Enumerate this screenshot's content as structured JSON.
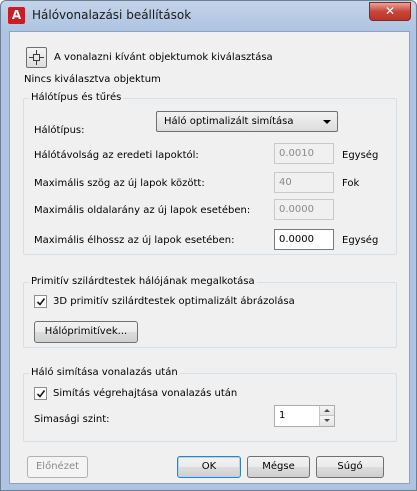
{
  "window": {
    "title": "Hálóvonalazási beállítások",
    "app_icon_letter": "A",
    "close_symbol": "✕"
  },
  "selection": {
    "button_label": "A vonalazni kívánt objektumok kiválasztása",
    "status": "Nincs kiválasztva objektum"
  },
  "mesh_type_group": {
    "title": "Hálótípus és tűrés",
    "mesh_type_label": "Hálótípus:",
    "mesh_type_value": "Háló optimalizált simítása",
    "fields": [
      {
        "label": "Hálótávolság az eredeti lapoktól:",
        "value": "0.0010",
        "unit": "Egység",
        "enabled": false
      },
      {
        "label": "Maximális szög az új lapok között:",
        "value": "40",
        "unit": "Fok",
        "enabled": false
      },
      {
        "label": "Maximális oldalarány az új lapok esetében:",
        "value": "0.0000",
        "unit": "",
        "enabled": false
      },
      {
        "label": "Maximális élhossz az új lapok esetében:",
        "value": "0.0000",
        "unit": "Egység",
        "enabled": true
      }
    ]
  },
  "primitive_group": {
    "title": "Primitív szilárdtestek hálójának megalkotása",
    "checkbox_label": "3D primitív szilárdtestek optimalizált ábrázolása",
    "checked": true,
    "button_label": "Hálóprimitívek..."
  },
  "smooth_group": {
    "title": "Háló simítása vonalazás után",
    "checkbox_label": "Simítás végrehajtása vonalazás után",
    "checked": true,
    "level_label": "Simasági szint:",
    "level_value": "1"
  },
  "footer": {
    "preview_label": "Előnézet",
    "ok_label": "OK",
    "cancel_label": "Mégse",
    "help_label": "Súgó"
  }
}
